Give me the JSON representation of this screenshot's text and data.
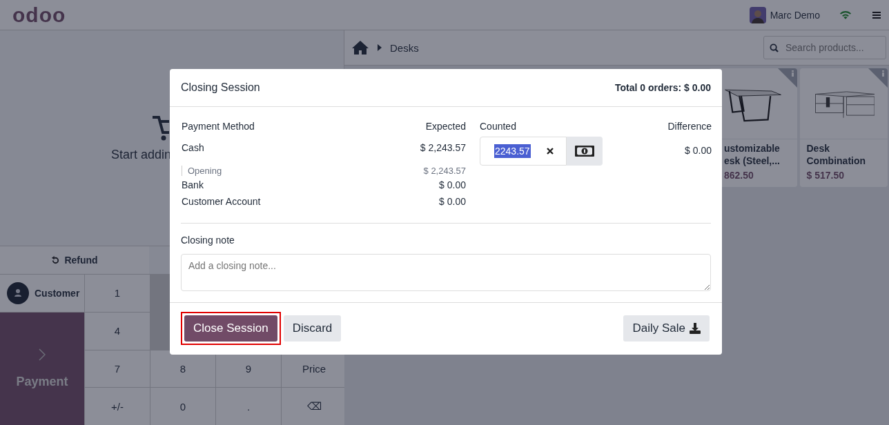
{
  "header": {
    "logo": "odoo",
    "user": "Marc Demo",
    "wifi_connected": true
  },
  "breadcrumb": {
    "category": "Desks"
  },
  "search": {
    "placeholder": "Search products..."
  },
  "order": {
    "empty_text": "Start addin"
  },
  "actions": {
    "refund": "Refund"
  },
  "customer_button": "Customer",
  "payment_button": "Payment",
  "keys": [
    {
      "label": "1"
    },
    {
      "label": "4"
    },
    {
      "label": "7"
    },
    {
      "label": "8"
    },
    {
      "label": "9"
    },
    {
      "label": "Price"
    },
    {
      "label": "+/-"
    },
    {
      "label": "0"
    },
    {
      "label": "."
    },
    {
      "label": "⌫"
    }
  ],
  "products": [
    {
      "name": "ustomizable\nesk (Steel,...",
      "price": "862.50",
      "kind": "frame-desk"
    },
    {
      "name": "Desk\nCombination",
      "price": "$ 517.50",
      "kind": "combo-desk"
    }
  ],
  "dialog": {
    "title": "Closing Session",
    "total": "Total 0 orders: $ 0.00",
    "columns": [
      "Payment Method",
      "Expected",
      "Counted",
      "Difference"
    ],
    "methods": [
      {
        "name": "Cash",
        "expected": "$ 2,243.57",
        "counted": "2243.57",
        "difference": "$ 0.00",
        "kind": "cash",
        "details": [
          {
            "name": "Opening",
            "amount": "$ 2,243.57"
          }
        ]
      },
      {
        "name": "Bank",
        "expected": "$ 0.00",
        "kind": "plain"
      },
      {
        "name": "Customer Account",
        "expected": "$ 0.00",
        "kind": "plain"
      }
    ],
    "note_label": "Closing note",
    "note_placeholder": "Add a closing note...",
    "buttons": [
      {
        "label": "Close Session",
        "kind": "primary",
        "highlighted": true
      },
      {
        "label": "Discard",
        "kind": "secondary",
        "highlighted": false
      },
      {
        "label": "Daily Sale",
        "kind": "download",
        "highlighted": false
      }
    ]
  }
}
